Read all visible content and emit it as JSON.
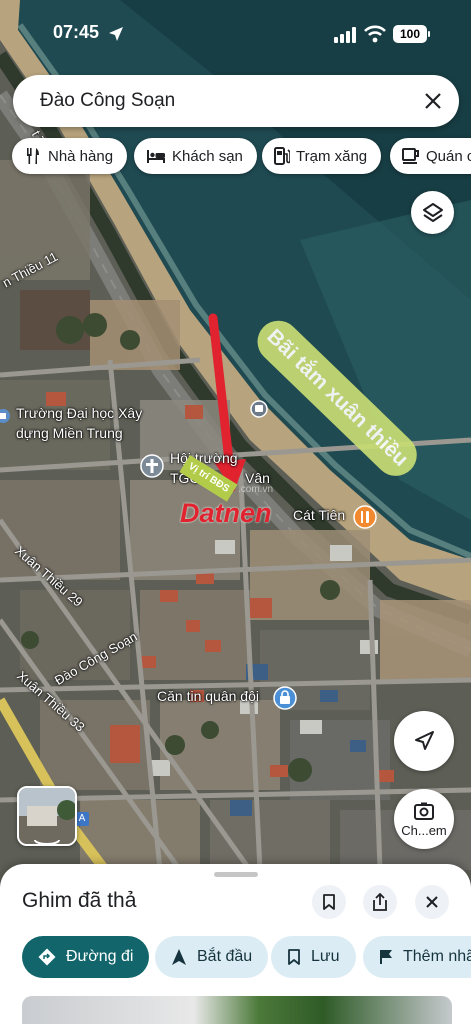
{
  "status_bar": {
    "time": "07:45",
    "battery": "100"
  },
  "search": {
    "value": "Đào Công Soạn"
  },
  "chips": [
    {
      "label": "Nhà hàng",
      "icon": "restaurant-icon"
    },
    {
      "label": "Khách sạn",
      "icon": "hotel-icon"
    },
    {
      "label": "Trạm xăng",
      "icon": "gas-station-icon"
    },
    {
      "label": "Quán c",
      "icon": "cafe-icon"
    }
  ],
  "map": {
    "beach_label": "Bãi tắm xuân thiều",
    "places": {
      "university_line1": "Trường Đại học Xây",
      "university_line2": "dựng Miền Trung",
      "hall_line1": "Hội trường",
      "hall_line2": "TGC",
      "hall_suffix": "Vân",
      "cat_tien": "Cát Tiên",
      "canteen": "Căn tin quân đội"
    },
    "roads": {
      "thanh": "t Thành",
      "thieu_11": "n Thiều 11",
      "thieu_29": "Xuân Thiều 29",
      "dao_cong_soan": "Đào Công Soạn",
      "thieu_33": "Xuân Thiều 33"
    },
    "pin_tag": "Vị trí BĐS",
    "watermark": "Datnen",
    "watermark_sub": ".com.vn"
  },
  "lens_label": "Ch...em",
  "sheet": {
    "title": "Ghim đã thả",
    "actions": [
      {
        "label": "Đường đi",
        "icon": "directions-icon"
      },
      {
        "label": "Bắt đầu",
        "icon": "navigation-icon"
      },
      {
        "label": "Lưu",
        "icon": "bookmark-icon"
      },
      {
        "label": "Thêm nhã",
        "icon": "flag-icon"
      }
    ]
  },
  "colors": {
    "sea": "#1e4a52",
    "sand": "#b9a37c",
    "accent_teal": "#12666b",
    "action_bg": "#dcecf4",
    "arrow_red": "#e0232f",
    "beach_label_bg": "#c7dc74"
  }
}
